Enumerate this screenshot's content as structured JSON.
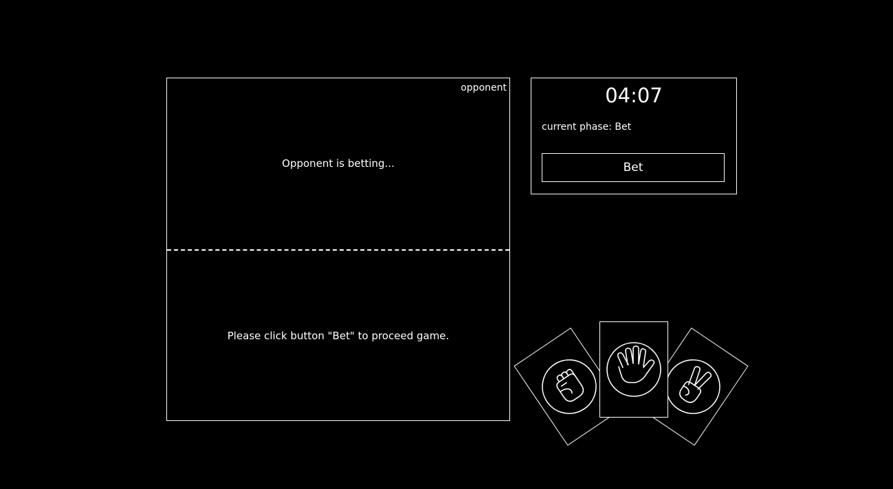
{
  "opponent_area": {
    "label": "opponent",
    "status": "Opponent is betting..."
  },
  "player_area": {
    "message": "Please click button \"Bet\" to proceed game."
  },
  "control_panel": {
    "timer": "04:07",
    "phase": "current phase: Bet",
    "bet_button_label": "Bet"
  },
  "hand": {
    "cards": [
      {
        "name": "rock",
        "icon": "fist-icon"
      },
      {
        "name": "paper",
        "icon": "open-hand-icon"
      },
      {
        "name": "scissors",
        "icon": "peace-sign-icon"
      }
    ]
  },
  "colors": {
    "background": "#000000",
    "foreground": "#ffffff"
  }
}
